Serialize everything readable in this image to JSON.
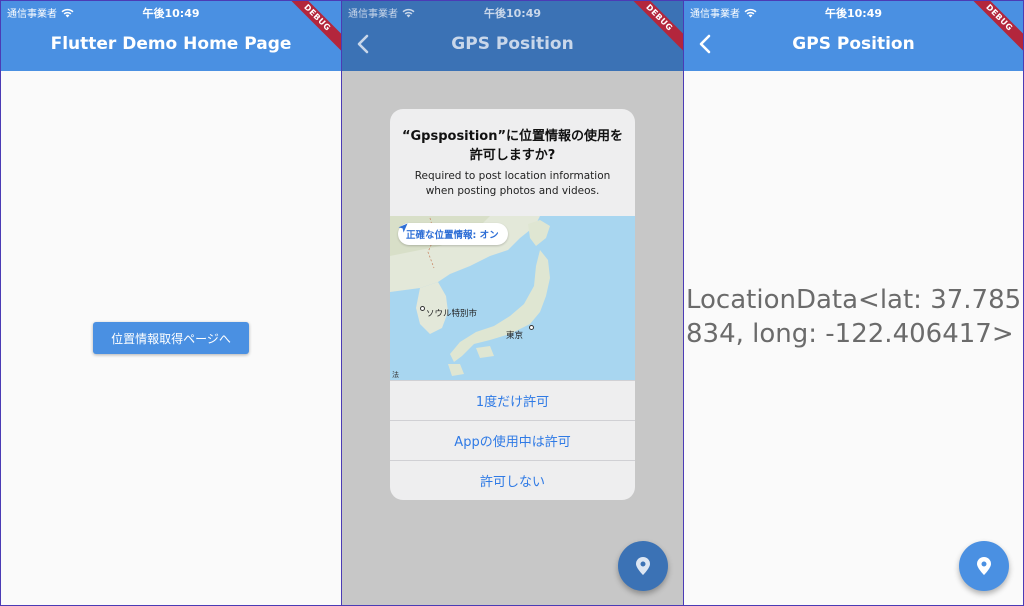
{
  "status_bar": {
    "carrier": "通信事業者",
    "time": "午後10:49"
  },
  "debug_label": "DEBUG",
  "screen1": {
    "title": "Flutter Demo Home Page",
    "button_label": "位置情報取得ページへ"
  },
  "screen2": {
    "title": "GPS Position",
    "dialog": {
      "title": "“Gpsposition”に位置情報の使用を許可しますか?",
      "message": "Required to post location information when posting photos and videos.",
      "precise_pill": "正確な位置情報: オン",
      "map_labels": {
        "seoul": "ソウル特別市",
        "tokyo": "東京",
        "legal": "法"
      },
      "options": [
        "1度だけ許可",
        "Appの使用中は許可",
        "許可しない"
      ]
    }
  },
  "screen3": {
    "title": "GPS Position",
    "location_text": "LocationData<lat: 37.785834, long: -122.406417>"
  },
  "colors": {
    "app_bar": "#4a90e2",
    "debug_ribbon": "#b3263c",
    "ios_blue": "#2f7ae5"
  },
  "icons": [
    "wifi-icon",
    "back-chevron-icon",
    "location-pin-icon",
    "location-arrow-icon"
  ]
}
